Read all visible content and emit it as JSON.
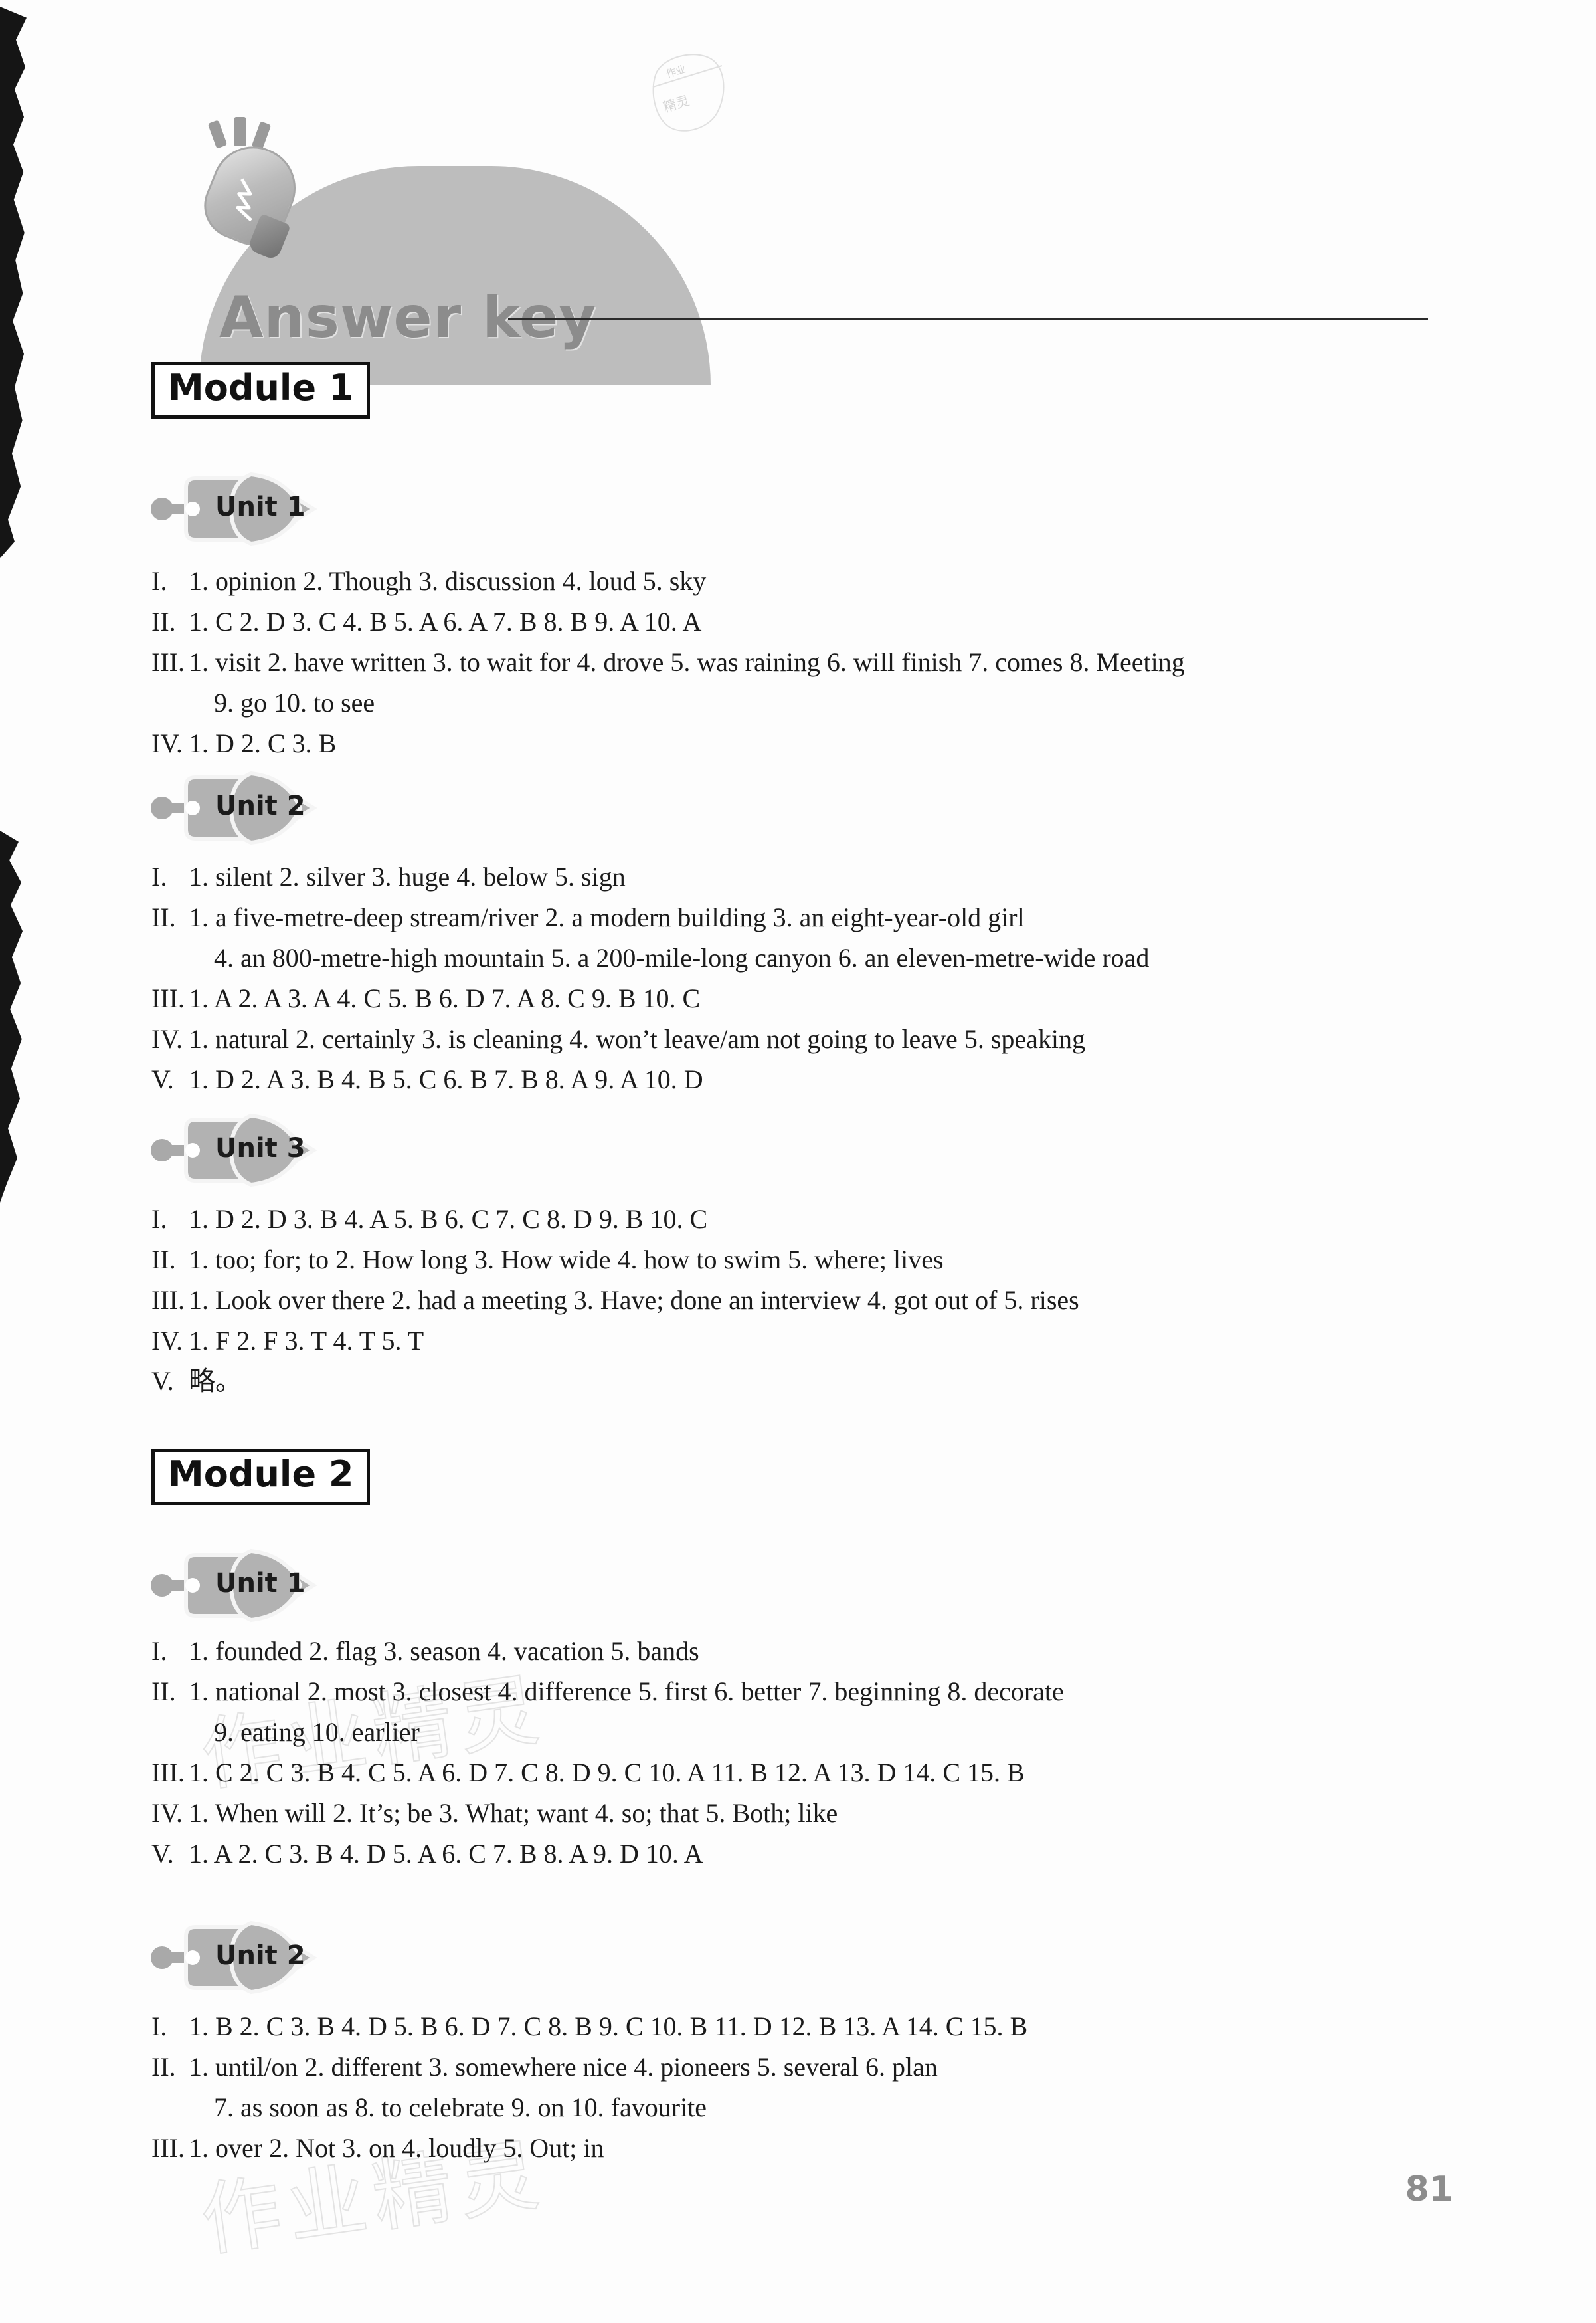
{
  "header": {
    "title": "Answer key",
    "bulb_icon": "light-bulb-icon",
    "watermark_logo": "zuoye-jingling-logo"
  },
  "watermarks": {
    "text": "作业精灵"
  },
  "page_number": "81",
  "modules": [
    {
      "label": "Module 1",
      "units": [
        {
          "label": "Unit 1",
          "lines": [
            {
              "numeral": "I.",
              "text": "1. opinion   2. Though   3. discussion   4. loud   5. sky",
              "continuation": false
            },
            {
              "numeral": "II.",
              "text": "1. C   2. D   3. C   4. B   5. A   6. A   7. B   8. B   9. A   10. A",
              "continuation": false
            },
            {
              "numeral": "III.",
              "text": "1. visit   2. have written   3. to wait for   4. drove   5. was raining   6. will finish   7. comes   8. Meeting",
              "continuation": false
            },
            {
              "numeral": "",
              "text": "9. go   10. to see",
              "continuation": true
            },
            {
              "numeral": "IV.",
              "text": "1. D   2. C   3. B",
              "continuation": false
            }
          ]
        },
        {
          "label": "Unit 2",
          "lines": [
            {
              "numeral": "I.",
              "text": "1. silent   2. silver   3. huge   4. below   5. sign",
              "continuation": false
            },
            {
              "numeral": "II.",
              "text": "1. a five-metre-deep stream/river   2. a modern building   3. an eight-year-old girl",
              "continuation": false
            },
            {
              "numeral": "",
              "text": "4. an 800-metre-high mountain   5. a 200-mile-long canyon   6. an eleven-metre-wide road",
              "continuation": true
            },
            {
              "numeral": "III.",
              "text": "1. A   2. A   3. A   4. C   5. B   6. D   7. A   8. C   9. B   10. C",
              "continuation": false
            },
            {
              "numeral": "IV.",
              "text": "1. natural   2. certainly   3. is cleaning   4. won’t leave/am not going to leave   5. speaking",
              "continuation": false
            },
            {
              "numeral": "V.",
              "text": "1. D   2. A   3. B   4. B   5. C   6. B   7. B   8. A   9. A   10. D",
              "continuation": false
            }
          ]
        },
        {
          "label": "Unit 3",
          "lines": [
            {
              "numeral": "I.",
              "text": "1. D   2. D   3. B   4. A   5. B   6. C   7. C   8. D   9. B   10. C",
              "continuation": false
            },
            {
              "numeral": "II.",
              "text": "1. too; for; to   2. How long   3. How wide   4. how to swim   5. where; lives",
              "continuation": false
            },
            {
              "numeral": "III.",
              "text": "1. Look over there   2. had a meeting   3. Have; done an interview   4. got out of   5. rises",
              "continuation": false
            },
            {
              "numeral": "IV.",
              "text": "1. F   2. F   3. T   4. T   5. T",
              "continuation": false
            },
            {
              "numeral": "V.",
              "text": "略。",
              "continuation": false
            }
          ]
        }
      ]
    },
    {
      "label": "Module 2",
      "units": [
        {
          "label": "Unit 1",
          "lines": [
            {
              "numeral": "I.",
              "text": "1. founded   2. flag   3. season   4. vacation   5. bands",
              "continuation": false
            },
            {
              "numeral": "II.",
              "text": "1. national   2. most   3. closest   4. difference   5. first   6. better   7. beginning   8. decorate",
              "continuation": false
            },
            {
              "numeral": "",
              "text": "9. eating   10. earlier",
              "continuation": true
            },
            {
              "numeral": "III.",
              "text": "1. C   2. C   3. B   4. C   5. A   6. D   7. C   8. D   9. C   10. A   11. B   12. A   13. D   14. C   15. B",
              "continuation": false
            },
            {
              "numeral": "IV.",
              "text": "1. When will   2. It’s; be   3. What; want   4. so; that   5. Both; like",
              "continuation": false
            },
            {
              "numeral": "V.",
              "text": "1. A   2. C   3. B   4. D   5. A   6. C   7. B   8. A   9. D   10. A",
              "continuation": false
            }
          ]
        },
        {
          "label": "Unit 2",
          "lines": [
            {
              "numeral": "I.",
              "text": "1. B   2. C   3. B   4. D   5. B   6. D   7. C   8. B   9. C   10. B   11. D   12. B   13. A   14. C   15. B",
              "continuation": false
            },
            {
              "numeral": "II.",
              "text": "1. until/on  2. different   3. somewhere nice   4. pioneers   5. several   6. plan",
              "continuation": false
            },
            {
              "numeral": "",
              "text": "7. as soon as   8. to celebrate   9. on   10. favourite",
              "continuation": true
            },
            {
              "numeral": "III.",
              "text": "1. over   2. Not   3. on   4. loudly   5. Out; in",
              "continuation": false
            }
          ]
        }
      ]
    }
  ],
  "layout": {
    "module_tops": [
      545,
      2180
    ],
    "unit_tops": [
      700,
      1150,
      1665,
      2320,
      2880
    ],
    "block_tops": [
      855,
      1300,
      1815,
      2465,
      3030
    ]
  }
}
